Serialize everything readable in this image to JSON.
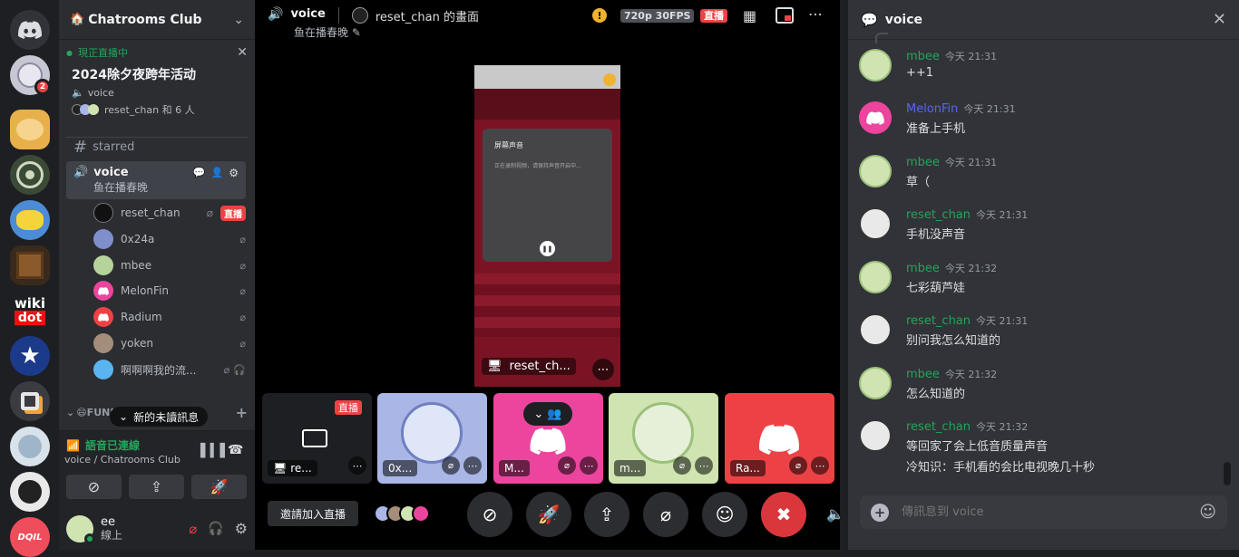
{
  "guild_list": {
    "items": [
      "discord-home-icon",
      "server-girl-avatar",
      "server-doge",
      "server-eye-emblem",
      "server-pikachu",
      "server-minecraft-table",
      "server-wikidot",
      "server-star",
      "server-square",
      "server-anime-1",
      "server-anime-2",
      "server-dqil"
    ],
    "notification_count": "2",
    "wikidot_top": "wiki",
    "wikidot_bottom": "dot",
    "dqil_label": "DQIL"
  },
  "server": {
    "name": "Chatrooms Club"
  },
  "event": {
    "status": "現正直播中",
    "title": "2024除夕夜跨年活动",
    "channel": "voice",
    "participants": "reset_chan 和 6 人"
  },
  "channels": {
    "starred": "starred",
    "voice": {
      "name": "voice",
      "status": "鱼在播春晚"
    },
    "members": [
      {
        "name": "reset_chan",
        "live": "直播",
        "color": "#111"
      },
      {
        "name": "0x24a",
        "color": "#7f8fcc"
      },
      {
        "name": "mbee",
        "color": "#b5d39a"
      },
      {
        "name": "MelonFin",
        "color": "#eb459e"
      },
      {
        "name": "Radium",
        "color": "#ed4245"
      },
      {
        "name": "yoken",
        "color": "#a48d7a"
      },
      {
        "name": "啊啊啊我的流...",
        "color": "#5ab4f0"
      }
    ],
    "category": "😄FUNNY",
    "unread_pill": "新的未讀訊息"
  },
  "voice_bar": {
    "status": "語音已連線",
    "location": "voice / Chatrooms Club"
  },
  "user": {
    "name": "ee",
    "status": "線上"
  },
  "stage": {
    "channel": "voice",
    "stream_owner": "reset_chan 的畫面",
    "subtitle": "鱼在播春晚",
    "quality": "720p 30FPS",
    "live_label": "直播",
    "stream_label": "reset_ch...",
    "phone_popup_title": "屏幕声音",
    "phone_popup_body": "正在录制视频，请保持声音开启中...",
    "invite_button": "邀請加入直播",
    "tiles": [
      {
        "label": "re...",
        "bg": "#1e1f22",
        "live": "直播"
      },
      {
        "label": "0x...",
        "bg": "#a9b6e6"
      },
      {
        "label": "M...",
        "bg": "#eb459e"
      },
      {
        "label": "m...",
        "bg": "#cfe4b0"
      },
      {
        "label": "Ra...",
        "bg": "#ed4245"
      }
    ]
  },
  "chat": {
    "channel": "voice",
    "placeholder": "傳訊息到 voice",
    "messages": [
      {
        "author": "mbee",
        "color": "#23a559",
        "time": "今天 21:31",
        "lines": [
          "++1"
        ],
        "avatar": "mbee"
      },
      {
        "author": "MelonFin",
        "color": "#5865f2",
        "time": "今天 21:31",
        "lines": [
          "准备上手机"
        ],
        "avatar": "melon"
      },
      {
        "author": "mbee",
        "color": "#23a559",
        "time": "今天 21:31",
        "lines": [
          "草（"
        ],
        "avatar": "mbee"
      },
      {
        "author": "reset_chan",
        "color": "#23a559",
        "time": "今天 21:31",
        "lines": [
          "手机没声音"
        ],
        "avatar": "reset"
      },
      {
        "author": "mbee",
        "color": "#23a559",
        "time": "今天 21:32",
        "lines": [
          "七彩葫芦娃"
        ],
        "avatar": "mbee"
      },
      {
        "author": "reset_chan",
        "color": "#23a559",
        "time": "今天 21:31",
        "lines": [
          "别问我怎么知道的"
        ],
        "avatar": "reset"
      },
      {
        "author": "mbee",
        "color": "#23a559",
        "time": "今天 21:32",
        "lines": [
          "怎么知道的"
        ],
        "avatar": "mbee"
      },
      {
        "author": "reset_chan",
        "color": "#23a559",
        "time": "今天 21:32",
        "lines": [
          "等回家了会上低音质量声音",
          "冷知识：手机看的会比电视晚几十秒"
        ],
        "avatar": "reset"
      }
    ]
  }
}
